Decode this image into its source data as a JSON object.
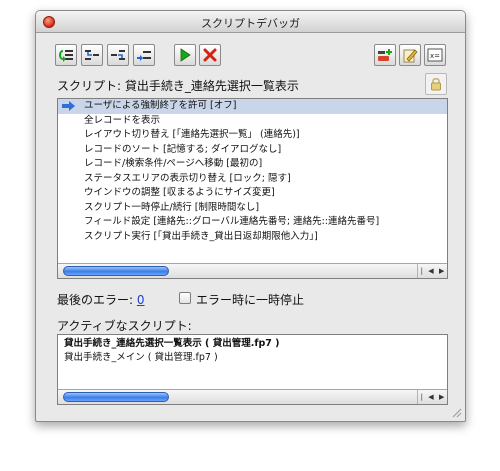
{
  "window": {
    "title": "スクリプトデバッガ"
  },
  "toolbar": {
    "icons": [
      "step-icon",
      "step-into-icon",
      "step-out-icon",
      "set-next-step-icon",
      "run-icon",
      "halt-icon",
      "edit-script-icon",
      "breakpoint-icon",
      "data-viewer-icon"
    ],
    "run_color": "#1aa61a",
    "halt_color": "#d62010"
  },
  "script_header": {
    "label": "スクリプト: 貸出手続き_連絡先選択一覧表示"
  },
  "steps": [
    "ユーザによる強制終了を許可 [オフ]",
    "全レコードを表示",
    "レイアウト切り替え [「連絡先選択一覧」 (連絡先)]",
    "レコードのソート [記憶する; ダイアログなし]",
    "レコード/検索条件/ページへ移動 [最初の]",
    "ステータスエリアの表示切り替え [ロック; 隠す]",
    "ウインドウの調整 [収まるようにサイズ変更]",
    "スクリプト一時停止/続行 [制限時間なし]",
    "フィールド設定 [連絡先::グローバル連絡先番号; 連絡先::連絡先番号]",
    "スクリプト実行 [「貸出手続き_貸出日返却期限他入力」]"
  ],
  "error": {
    "label": "最後のエラー:",
    "value": "0"
  },
  "pause_on_error": {
    "label": "エラー時に一時停止",
    "checked": false
  },
  "active_scripts": {
    "label": "アクティブなスクリプト:",
    "items": [
      "貸出手続き_連絡先選択一覧表示 ( 貸出管理.fp7 )",
      "貸出手続き_メイン ( 貸出管理.fp7 )"
    ]
  },
  "scroll": {
    "left_arrow": "◀",
    "right_arrow": "▶",
    "separator": "|"
  }
}
